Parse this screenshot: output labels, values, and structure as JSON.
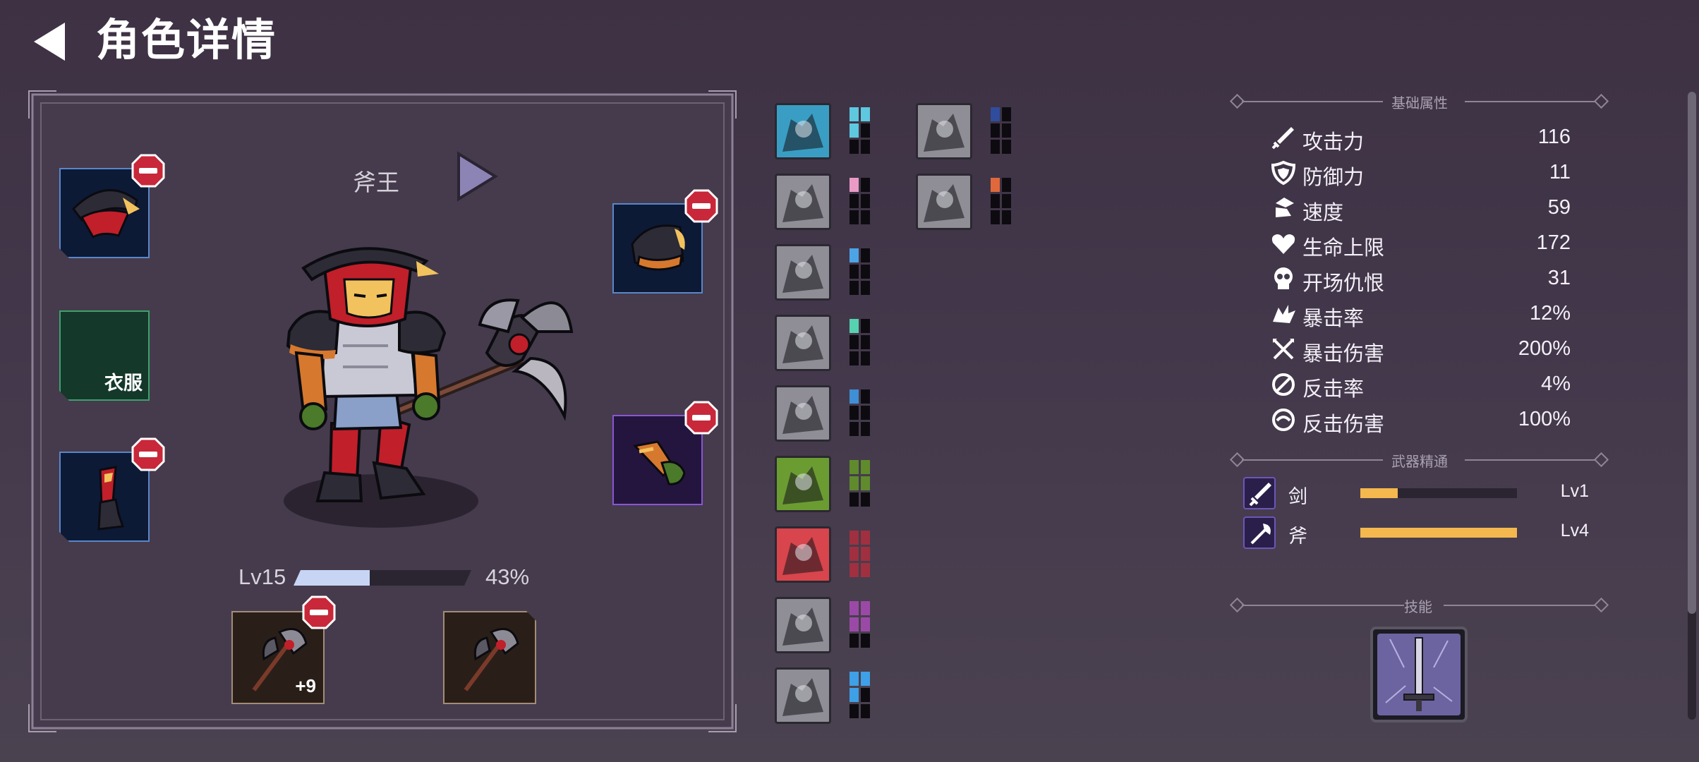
{
  "header": {
    "title": "角色详情",
    "back_icon": "back-arrow-icon"
  },
  "character": {
    "name": "斧王",
    "level_label": "Lv15",
    "xp_percent_label": "43%",
    "xp_fraction": 0.43
  },
  "equipment": {
    "clothes_label": "衣服",
    "weapon_enhance_label": "+9"
  },
  "relics": {
    "column_1": [
      {
        "icon": "barbarian-relic-icon",
        "color": "#5ec8de",
        "pips": [
          1,
          1,
          1,
          0,
          0,
          0
        ]
      },
      {
        "icon": "boot-relic-icon",
        "color": "#e99bc6",
        "pips": [
          1,
          0,
          0,
          0,
          0,
          0
        ]
      },
      {
        "icon": "cross-bones-relic-icon",
        "color": "#4ca4e6",
        "pips": [
          1,
          0,
          0,
          0,
          0,
          0
        ]
      },
      {
        "icon": "eye-relic-icon",
        "color": "#57d2b0",
        "pips": [
          1,
          0,
          0,
          0,
          0,
          0
        ]
      },
      {
        "icon": "fist-relic-icon",
        "color": "#3f8fd6",
        "pips": [
          1,
          0,
          0,
          0,
          0,
          0
        ]
      },
      {
        "icon": "viking-helmet-relic-icon",
        "color": "#5f8b2c",
        "pips": [
          1,
          1,
          1,
          1,
          0,
          0
        ]
      },
      {
        "icon": "blade-relic-icon",
        "color": "#a0303f",
        "pips": [
          1,
          1,
          1,
          1,
          1,
          1
        ]
      },
      {
        "icon": "scroll-face-relic-icon",
        "color": "#9a4aa6",
        "pips": [
          1,
          1,
          1,
          1,
          0,
          0
        ]
      },
      {
        "icon": "staff-relic-icon",
        "color": "#3ea0e6",
        "pips": [
          1,
          1,
          1,
          0,
          0,
          0
        ]
      }
    ],
    "column_2": [
      {
        "icon": "cloaked-figures-relic-icon",
        "color": "#2f4d9c",
        "pips": [
          1,
          0,
          0,
          0,
          0,
          0
        ]
      },
      {
        "icon": "skull-relic-icon",
        "color": "#e0683a",
        "pips": [
          1,
          0,
          0,
          0,
          0,
          0
        ]
      }
    ]
  },
  "stats": {
    "section_title": "基础属性",
    "rows": [
      {
        "icon": "sword-icon",
        "label": "攻击力",
        "value": "116"
      },
      {
        "icon": "shield-icon",
        "label": "防御力",
        "value": "11"
      },
      {
        "icon": "winged-boot-icon",
        "label": "速度",
        "value": "59"
      },
      {
        "icon": "heart-icon",
        "label": "生命上限",
        "value": "172"
      },
      {
        "icon": "skull-icon",
        "label": "开场仇恨",
        "value": "31"
      },
      {
        "icon": "crit-burst-icon",
        "label": "暴击率",
        "value": "12%"
      },
      {
        "icon": "crossed-swords-icon",
        "label": "暴击伤害",
        "value": "200%"
      },
      {
        "icon": "counter-slash-icon",
        "label": "反击率",
        "value": "4%"
      },
      {
        "icon": "counter-swirl-icon",
        "label": "反击伤害",
        "value": "100%"
      }
    ]
  },
  "mastery": {
    "section_title": "武器精通",
    "rows": [
      {
        "icon": "sword-mastery-icon",
        "name": "剑",
        "level": "Lv1",
        "fraction": 0.24
      },
      {
        "icon": "axe-mastery-icon",
        "name": "斧",
        "level": "Lv4",
        "fraction": 1.0
      }
    ]
  },
  "skills": {
    "section_title": "技能",
    "items": [
      {
        "icon": "glowing-sword-skill-icon"
      }
    ]
  },
  "colors": {
    "background": "#43384b",
    "xp_fill": "#c8d4f4",
    "mastery_fill": "#f4b84e",
    "remove_badge": "#c8283a",
    "slot_blue_border": "#5a86c9",
    "slot_green_border": "#3fa06c",
    "slot_purple_border": "#8a55d6"
  }
}
